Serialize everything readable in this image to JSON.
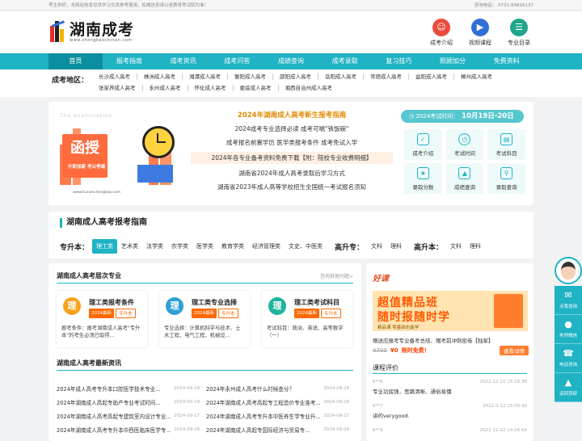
{
  "topbar": {
    "left": "考生你好，本网站信息仅供学习交流参考使用，权威信息请以省教育考试院为准！",
    "right": "咨询电话： 0731-89826137"
  },
  "logo": {
    "cn": "湖南成考",
    "url": "www.zhongkaochinan.com"
  },
  "quick_links": [
    {
      "label": "成考介绍",
      "icon": "person-icon",
      "color": "#e94b3c"
    },
    {
      "label": "视频课程",
      "icon": "video-icon",
      "color": "#2f6fd6"
    },
    {
      "label": "专业目录",
      "icon": "book-icon",
      "color": "#1fa58c"
    }
  ],
  "nav": [
    "首页",
    "报考指南",
    "成考资讯",
    "成考问答",
    "成绩查询",
    "成考录取",
    "复习技巧",
    "照顾加分",
    "免费资料"
  ],
  "region": {
    "title": "成考地区：",
    "row1": [
      "长沙成人高考",
      "株洲成人高考",
      "湘潭成人高考",
      "衡阳成人高考",
      "邵阳成人高考",
      "岳阳成人高考",
      "常德成人高考",
      "益阳成人高考",
      "郴州成人高考"
    ],
    "row2": [
      "张家界成人高考",
      "永州成人高考",
      "怀化成人高考",
      "娄底成人高考",
      "湘西自治州成人高考"
    ]
  },
  "promo": {
    "header": "The examination",
    "box": "函授",
    "sub": "升职加薪 考公考编",
    "url": "www.hunanchengkao.com"
  },
  "banner": {
    "main": "2024年湖南成人高考新生报考指南",
    "lines": [
      "2024成考专业选择必读 成考可喘\"铁饭碗\"",
      "成考报名前置学历 医学类报考条件 成考免试入学"
    ],
    "highlight": "2024年各专业备考资料免费下载【附：院校专业收费明细】",
    "lines2": [
      "湖南省2024年成人高考录取后学习方式",
      "湖南省2023年成人高等学校招生全国统一考试报名须知"
    ]
  },
  "exam_time": {
    "label": "2024考试时间：",
    "value": "10月19日-20日"
  },
  "tiles": [
    {
      "label": "成考介绍",
      "icon": "checklist-icon"
    },
    {
      "label": "考试时间",
      "icon": "clock-icon"
    },
    {
      "label": "考试科目",
      "icon": "document-icon"
    },
    {
      "label": "录取分数",
      "icon": "score-icon"
    },
    {
      "label": "成绩查询",
      "icon": "chart-icon"
    },
    {
      "label": "录取查询",
      "icon": "search-icon"
    }
  ],
  "guide": {
    "title": "湖南成人高考报考指南",
    "zsb_label": "专升本：",
    "zsb": [
      "理工类",
      "艺术类",
      "法学类",
      "农学类",
      "医学类",
      "教育学类",
      "经济管理类",
      "文史、中医类"
    ],
    "gzz_label": "高升专：",
    "gzz": [
      "文科",
      "理科"
    ],
    "gsb_label": "高升本：",
    "gsb": [
      "文科",
      "理科"
    ]
  },
  "majors": {
    "title": "湖南成人高考层次专业",
    "more": "咨询其他问题>",
    "cards": [
      {
        "char": "理",
        "title": "理工类报考条件",
        "tags": [
          "2024最新",
          "专升本"
        ],
        "desc": "报考条件：报考湖南成人高考\"专升本\"的考生必须已取得..."
      },
      {
        "char": "理",
        "title": "理工类专业选择",
        "tags": [
          "2024最新",
          "专升本"
        ],
        "desc": "专业选择：计算机科学与技术、土木工程、电气工程、机械设..."
      },
      {
        "char": "理",
        "title": "理工类考试科目",
        "tags": [
          "2024最新",
          "专升本"
        ],
        "desc": "考试科目：政治、英语、高等数学（一）"
      }
    ]
  },
  "news": {
    "title": "湖南成人高考最新资讯",
    "items": [
      {
        "t1": "2024年成人高考专升本口腔医学技术专业...",
        "d1": "2024-09-29",
        "t2": "2024年永州成人高考什么时候查分？",
        "d2": "2024-09-29"
      },
      {
        "t1": "2024年湖南成人高起专助产专业考试时间...",
        "d1": "2024-09-29",
        "t2": "2024年湖南成人高考高起专工程造价专业准考...",
        "d2": "2024-09-29"
      },
      {
        "t1": "2024年湖南成人高考高起专建筑室内设计专业...",
        "d1": "2024-09-27",
        "t2": "2024年湖南成人高考专升本中医养生学专业升...",
        "d2": "2024-09-27"
      },
      {
        "t1": "2024年湖南成人高考专升本中西医临床医学专...",
        "d1": "2024-09-26",
        "t2": "2024年湖南成人高起专国际经济与贸易专...",
        "d2": "2024-09-26"
      }
    ]
  },
  "course": {
    "title": "好课",
    "img1": "超值精品班",
    "img2": "随时报随时学",
    "img3": "精品课 零基础也能学",
    "desc": "赠送应报考专业备考总结、赠考前冲刺密卷【独家】",
    "old_price": "¥700",
    "new_price": "¥0",
    "limited": "限时免费！",
    "buy": "查看详情"
  },
  "reviews": {
    "title": "课程评价",
    "items": [
      {
        "name": "6**6",
        "date": "2022-12-15 15:29:38",
        "text": "专业功底强，思路清晰、通俗易懂"
      },
      {
        "name": "6**7",
        "date": "2022-3-12 15:50:40",
        "text": "讲的verygood."
      },
      {
        "name": "6**9",
        "date": "2022-11-22 14:26:54",
        "text": ""
      }
    ]
  },
  "floatbar": [
    "点我咨询",
    "老师微信",
    "电话咨询",
    "返回顶部"
  ]
}
